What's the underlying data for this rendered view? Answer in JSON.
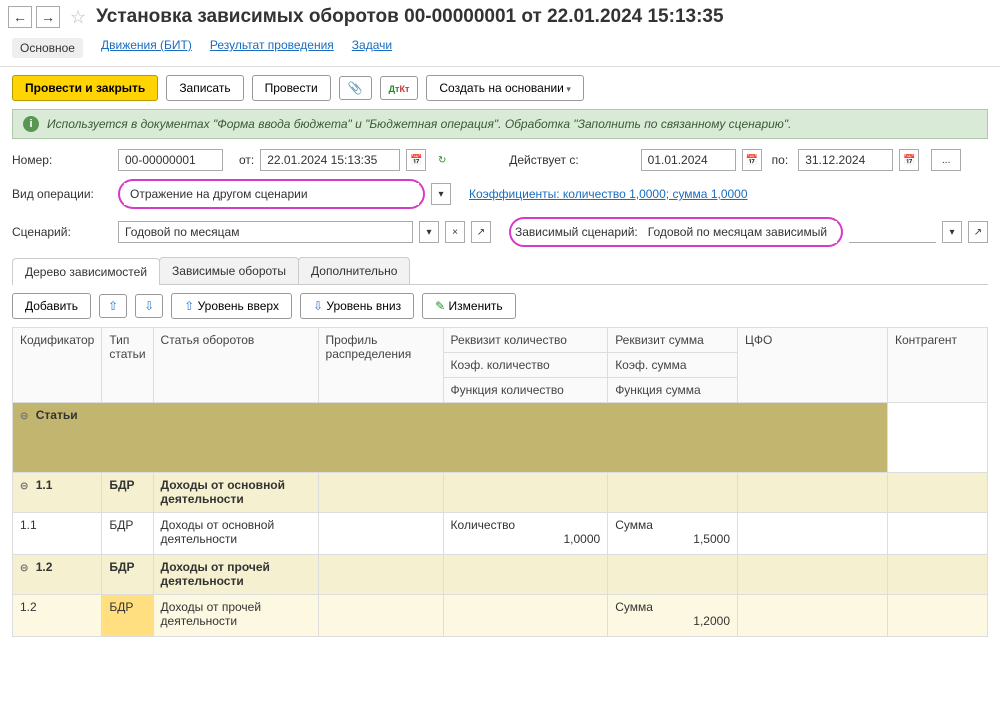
{
  "header": {
    "title": "Установка зависимых оборотов 00-00000001 от 22.01.2024 15:13:35"
  },
  "tabs": {
    "main": "Основное",
    "bit": "Движения (БИТ)",
    "result": "Результат проведения",
    "tasks": "Задачи"
  },
  "toolbar": {
    "post_close": "Провести и закрыть",
    "save": "Записать",
    "post": "Провести",
    "create_based": "Создать на основании"
  },
  "info": "Используется в документах \"Форма ввода бюджета\" и \"Бюджетная операция\". Обработка \"Заполнить по связанному сценарию\".",
  "form": {
    "number_label": "Номер:",
    "number": "00-00000001",
    "from_label": "от:",
    "date": "22.01.2024 15:13:35",
    "active_from_label": "Действует с:",
    "active_from": "01.01.2024",
    "to_label": "по:",
    "active_to": "31.12.2024",
    "op_type_label": "Вид операции:",
    "op_type": "Отражение на другом сценарии",
    "coeff_link": "Коэффициенты: количество 1,0000; сумма 1,0000",
    "scenario_label": "Сценарий:",
    "scenario": "Годовой по месяцам",
    "dep_scenario_label": "Зависимый сценарий:",
    "dep_scenario": "Годовой по месяцам зависимый"
  },
  "subtabs": {
    "tree": "Дерево зависимостей",
    "dep": "Зависимые обороты",
    "extra": "Дополнительно"
  },
  "grid_tb": {
    "add": "Добавить",
    "level_up": "Уровень вверх",
    "level_down": "Уровень вниз",
    "edit": "Изменить"
  },
  "headers": {
    "code": "Кодификатор",
    "type": "Тип статьи",
    "article": "Статья оборотов",
    "profile": "Профиль распределения",
    "req_qty": "Реквизит количество",
    "req_sum": "Реквизит сумма",
    "coef_qty": "Коэф. количество",
    "coef_sum": "Коэф. сумма",
    "func_qty": "Функция количество",
    "func_sum": "Функция сумма",
    "cfo": "ЦФО",
    "contr": "Контрагент"
  },
  "rows": {
    "group": "Статьи",
    "r11_code": "1.1",
    "r11_type": "БДР",
    "r11_art": "Доходы от основной деятельности",
    "r11d_code": "1.1",
    "r11d_type": "БДР",
    "r11d_art": "Доходы от основной деятельности",
    "r11d_qty": "Количество",
    "r11d_sum": "Сумма",
    "r11d_cq": "1,0000",
    "r11d_cs": "1,5000",
    "r12_code": "1.2",
    "r12_type": "БДР",
    "r12_art": "Доходы от прочей деятельности",
    "r12d_code": "1.2",
    "r12d_type": "БДР",
    "r12d_art": "Доходы от прочей деятельности",
    "r12d_sum": "Сумма",
    "r12d_cs": "1,2000"
  }
}
